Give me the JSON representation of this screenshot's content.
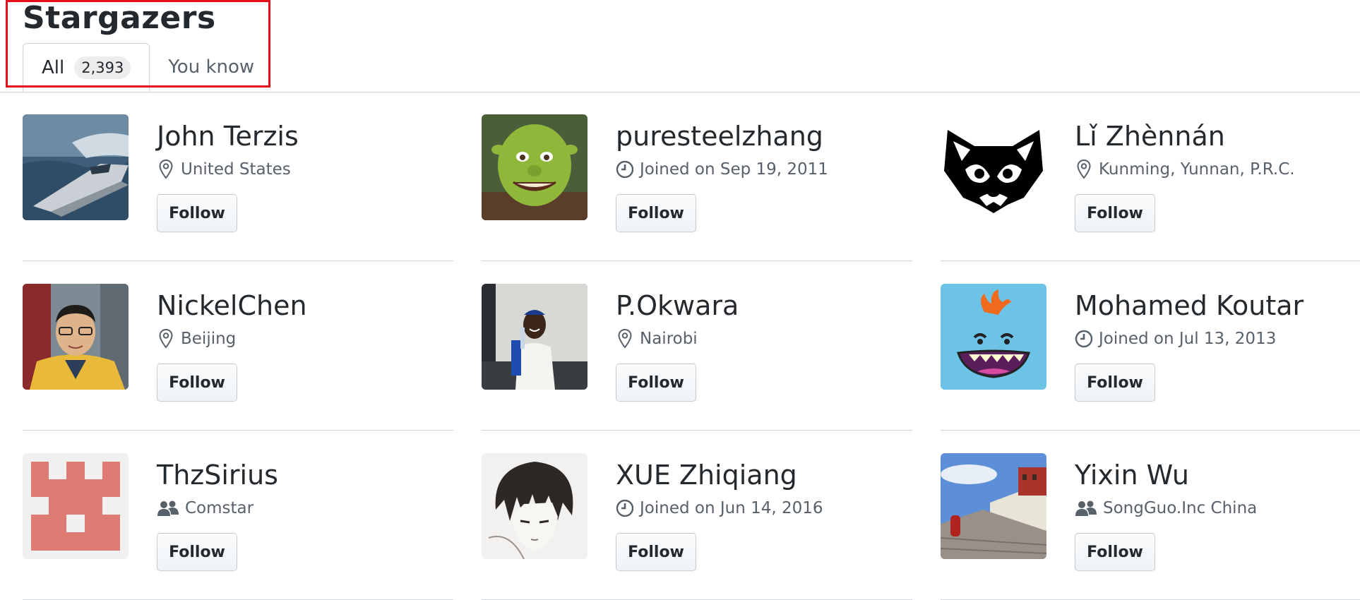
{
  "header": {
    "title": "Stargazers",
    "tabs": [
      {
        "label": "All",
        "count": "2,393",
        "selected": true
      },
      {
        "label": "You know",
        "selected": false
      }
    ]
  },
  "users": [
    {
      "name": "John Terzis",
      "meta_icon": "location-icon",
      "meta": "United States",
      "follow_label": "Follow"
    },
    {
      "name": "puresteelzhang",
      "meta_icon": "clock-icon",
      "meta": "Joined on Sep 19, 2011",
      "follow_label": "Follow"
    },
    {
      "name": "Lǐ Zhènnán",
      "meta_icon": "location-icon",
      "meta": "Kunming, Yunnan, P.R.C.",
      "follow_label": "Follow"
    },
    {
      "name": "NickelChen",
      "meta_icon": "location-icon",
      "meta": "Beijing",
      "follow_label": "Follow"
    },
    {
      "name": "P.Okwara",
      "meta_icon": "location-icon",
      "meta": "Nairobi",
      "follow_label": "Follow"
    },
    {
      "name": "Mohamed Koutar",
      "meta_icon": "clock-icon",
      "meta": "Joined on Jul 13, 2013",
      "follow_label": "Follow"
    },
    {
      "name": "ThzSirius",
      "meta_icon": "organization-icon",
      "meta": "Comstar",
      "follow_label": "Follow"
    },
    {
      "name": "XUE Zhiqiang",
      "meta_icon": "clock-icon",
      "meta": "Joined on Jun 14, 2016",
      "follow_label": "Follow"
    },
    {
      "name": "Yixin Wu",
      "meta_icon": "organization-icon",
      "meta": "SongGuo.Inc China",
      "follow_label": "Follow"
    }
  ],
  "colors": {
    "highlight": "#e3101c",
    "text": "#24292e",
    "muted": "#586069",
    "border": "#d1d5da"
  }
}
